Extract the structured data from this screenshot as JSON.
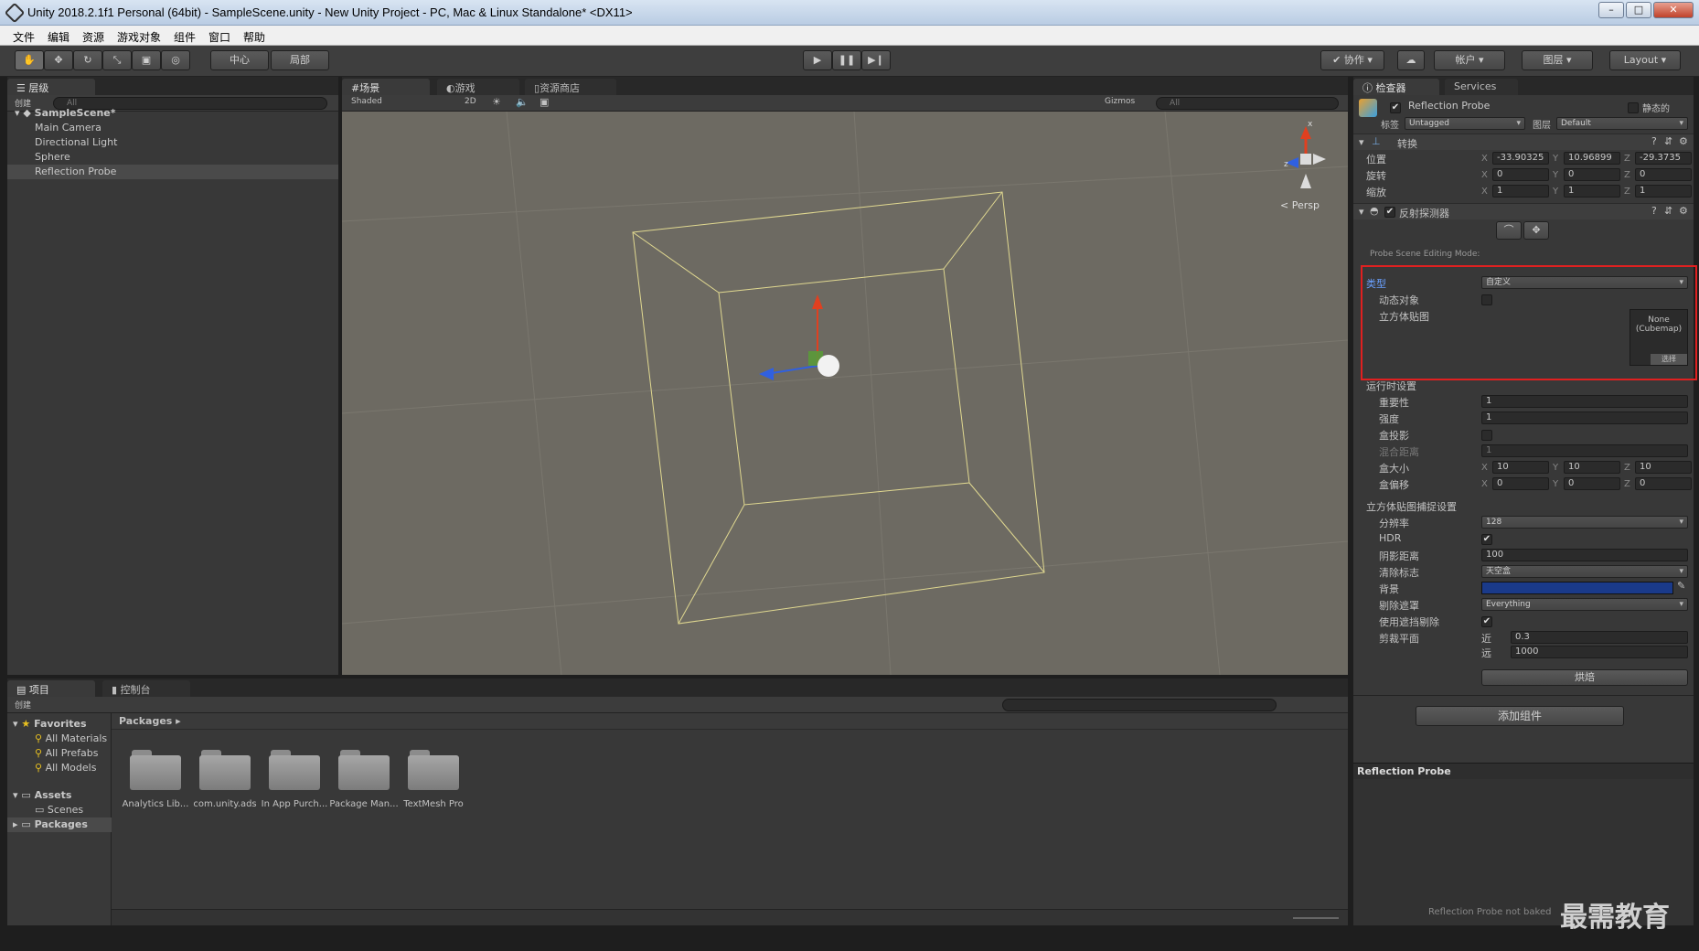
{
  "window": {
    "title": "Unity 2018.2.1f1 Personal (64bit) - SampleScene.unity - New Unity Project - PC, Mac & Linux Standalone* <DX11>"
  },
  "menu": [
    "文件",
    "编辑",
    "资源",
    "游戏对象",
    "组件",
    "窗口",
    "帮助"
  ],
  "toolbar": {
    "pivot": "中心",
    "local": "局部",
    "collab": "协作",
    "account": "帐户",
    "layers": "图层",
    "layout": "Layout"
  },
  "hierarchy": {
    "tab": "层级",
    "create": "创建",
    "search": "All",
    "scene": "SampleScene*",
    "items": [
      "Main Camera",
      "Directional Light",
      "Sphere",
      "Reflection Probe"
    ]
  },
  "scene_view": {
    "tabs": [
      "场景",
      "游戏",
      "资源商店"
    ],
    "shading": "Shaded",
    "mode_2d": "2D",
    "gizmos": "Gizmos",
    "search": "All",
    "persp": "< Persp",
    "gizmo_x": "x",
    "gizmo_z": "z"
  },
  "project": {
    "tabs": [
      "项目",
      "控制台"
    ],
    "create": "创建",
    "favorites_label": "Favorites",
    "favorites": [
      "All Materials",
      "All Prefabs",
      "All Models"
    ],
    "assets_label": "Assets",
    "assets_children": [
      "Scenes"
    ],
    "packages_label": "Packages",
    "breadcrumb": "Packages",
    "folders": [
      "Analytics Lib...",
      "com.unity.ads",
      "In App Purch...",
      "Package Man...",
      "TextMesh Pro"
    ]
  },
  "inspector": {
    "tabs": [
      "检查器",
      "Services"
    ],
    "object_name": "Reflection Probe",
    "static_label": "静态的",
    "tag_label": "标签",
    "tag_value": "Untagged",
    "layer_label": "图层",
    "layer_value": "Default",
    "transform": {
      "title": "转换",
      "position_label": "位置",
      "rotation_label": "旋转",
      "scale_label": "缩放",
      "position": [
        "-33.90325",
        "10.96899",
        "-29.3735"
      ],
      "rotation": [
        "0",
        "0",
        "0"
      ],
      "scale": [
        "1",
        "1",
        "1"
      ]
    },
    "probe": {
      "title": "反射探测器",
      "editing_mode": "Probe Scene Editing Mode:",
      "type_label": "类型",
      "type_value": "自定义",
      "dynamic_label": "动态对象",
      "cubemap_label": "立方体贴图",
      "cubemap_value": "None\n(Cubemap)",
      "cubemap_select": "选择",
      "runtime_label": "运行时设置",
      "importance_label": "重要性",
      "importance": "1",
      "intensity_label": "强度",
      "intensity": "1",
      "box_projection_label": "盒投影",
      "blend_distance_label": "混合距离",
      "blend_distance": "1",
      "box_size_label": "盒大小",
      "box_size": [
        "10",
        "10",
        "10"
      ],
      "box_offset_label": "盒偏移",
      "box_offset": [
        "0",
        "0",
        "0"
      ],
      "capture_label": "立方体贴图捕捉设置",
      "resolution_label": "分辨率",
      "resolution": "128",
      "hdr_label": "HDR",
      "shadow_distance_label": "阴影距离",
      "shadow_distance": "100",
      "clear_flags_label": "清除标志",
      "clear_flags": "天空盒",
      "background_label": "背景",
      "culling_label": "剔除遮罩",
      "culling": "Everything",
      "occlusion_label": "使用遮挡剔除",
      "clipping_label": "剪裁平面",
      "near_label": "近",
      "near": "0.3",
      "far_label": "远",
      "far": "1000",
      "bake": "烘焙"
    },
    "add_component": "添加组件",
    "preview_title": "Reflection Probe",
    "not_baked": "Reflection Probe not baked"
  },
  "watermark": "最需教育",
  "colors": {
    "highlight_border": "#e02020",
    "background_color": "#1a3a8a"
  }
}
